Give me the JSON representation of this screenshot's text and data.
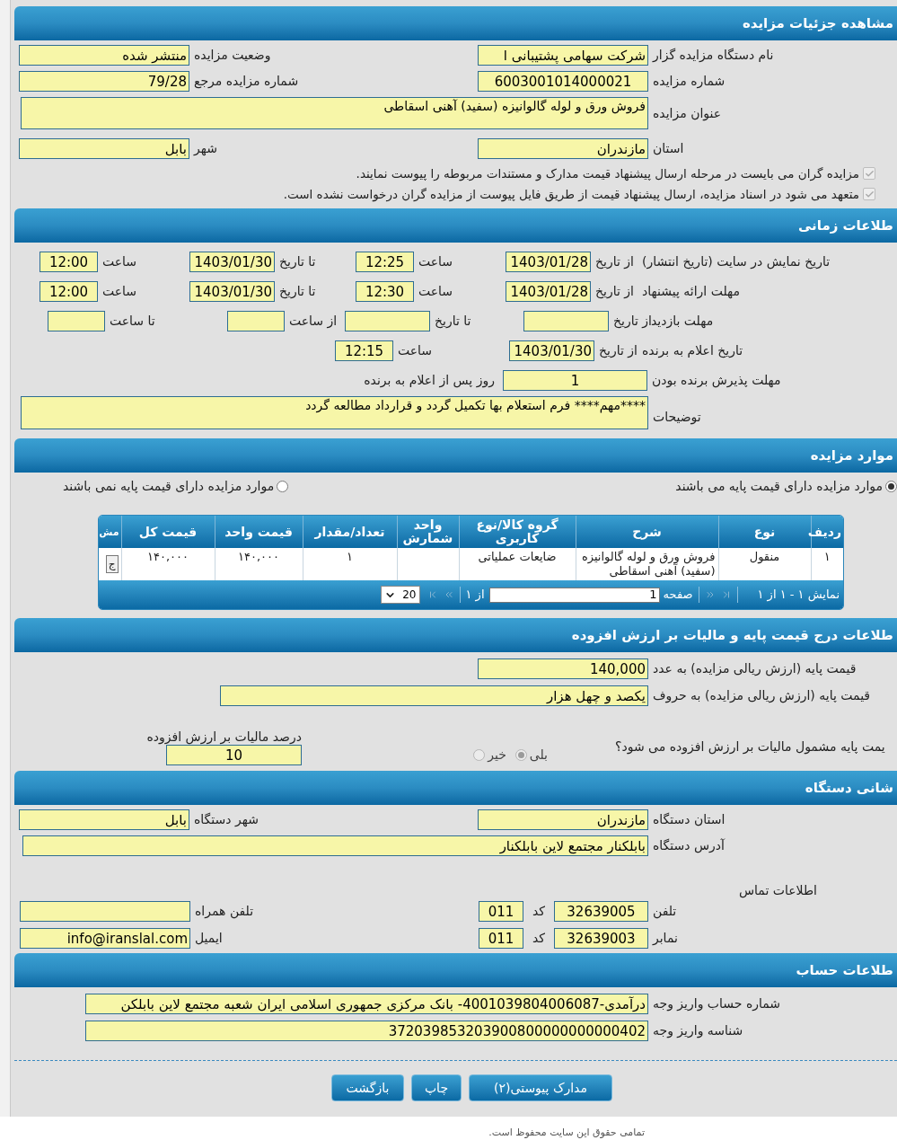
{
  "details": {
    "title": "مشاهده جزئیات مزایده",
    "rows": [
      {
        "kind": "pair",
        "fields": [
          {
            "label": "نام دستگاه مزایده گزار",
            "value": "شرکت سهامی پشتیبانی ا"
          },
          {
            "label": "وضعیت مزایده",
            "value": "منتشر شده"
          }
        ]
      },
      {
        "kind": "pair",
        "fields": [
          {
            "label": "شماره مزایده",
            "value": "6003001014000021"
          },
          {
            "label": "شماره مزایده مرجع",
            "value": "79/28"
          }
        ]
      },
      {
        "kind": "text",
        "fields": [
          {
            "label": "عنوان مزایده",
            "value": "فروش ورق و لوله گالوانیزه (سفید) آهنی اسقاطی"
          }
        ]
      },
      {
        "kind": "pair",
        "fields": [
          {
            "label": "استان",
            "value": "مازندران"
          },
          {
            "label": "شهر",
            "value": "بابل"
          }
        ]
      }
    ],
    "checks": [
      {
        "label": "مزایده گران می بایست در مرحله ارسال پیشنهاد قیمت مدارک و مستندات مربوطه را پیوست نمایند.",
        "checked": true,
        "disabled": true
      },
      {
        "label": "متعهد می شود در اسناد مزایده، ارسال پیشنهاد قیمت از طریق فایل پیوست از مزایده گران درخواست نشده است.",
        "checked": true,
        "disabled": true
      }
    ]
  },
  "time": {
    "title": "طلاعات زمانی",
    "rows": [
      {
        "label": "تاریخ نمایش در سایت (تاریخ انتشار)",
        "parts": [
          {
            "label": "از تاریخ",
            "value": "1403/01/28"
          },
          {
            "label": "ساعت",
            "value": "12:25"
          },
          {
            "label": "تا تاریخ",
            "value": "1403/01/30"
          },
          {
            "label": "ساعت",
            "value": "12:00"
          }
        ]
      },
      {
        "label": "مهلت ارائه پیشنهاد",
        "parts": [
          {
            "label": "از تاریخ",
            "value": "1403/01/28"
          },
          {
            "label": "ساعت",
            "value": "12:30"
          },
          {
            "label": "تا تاریخ",
            "value": "1403/01/30"
          },
          {
            "label": "ساعت",
            "value": "12:00"
          }
        ]
      },
      {
        "label": "مهلت بازدید",
        "parts": [
          {
            "label": "از تاریخ"
          },
          {
            "label": "تا تاریخ"
          },
          {
            "label": "از ساعت"
          },
          {
            "label": "تا ساعت"
          }
        ]
      },
      {
        "label": "تاریخ اعلام به برنده",
        "parts": [
          {
            "label": "از تاریخ",
            "value": "1403/01/30"
          },
          {
            "label": "ساعت",
            "value": "12:15"
          }
        ]
      }
    ],
    "acceptance": {
      "label": "مهلت پذیرش برنده بودن",
      "value": "1",
      "suffix": "روز پس از اعلام به برنده"
    },
    "notes": {
      "label": "توضیحات",
      "value": "****مهم**** فرم استعلام بها تکمیل گردد و قرارداد مطالعه گردد"
    }
  },
  "items": {
    "title": "موارد مزایده",
    "options": [
      {
        "label": "موارد مزایده دارای قیمت پایه می باشند",
        "selected": true
      },
      {
        "label": "موارد مزایده دارای قیمت پایه نمی باشند",
        "selected": false
      }
    ],
    "table": {
      "columns": [
        "ردیف",
        "نوع",
        "شرح",
        "گروه کالا/نوع کاربری",
        "واحد شمارش",
        "تعداد/مقدار",
        "قیمت واحد",
        "قیمت کل",
        "مش"
      ],
      "rows": [
        {
          "cells": [
            "۱",
            "منقول",
            "فروش ورق و لوله گالوانیزه (سفید) آهنی اسقاطی",
            "ضایعات عملیاتی",
            null,
            "۱",
            "۱۴۰,۰۰۰",
            "۱۴۰,۰۰۰"
          ],
          "action": "ج"
        }
      ],
      "pager": {
        "summary": "نمایش ۱ - ۱ از ۱",
        "page_label": "صفحه",
        "page": "1",
        "total": "از ۱",
        "page_size": "20"
      }
    }
  },
  "tax": {
    "title": "طلاعات درج قیمت پایه و مالیات بر ارزش افزوده",
    "rows": [
      {
        "label": "قیمت پایه (ارزش ریالی مزایده) به عدد",
        "value": "140,000"
      },
      {
        "label": "قیمت پایه (ارزش ریالی مزایده) به حروف",
        "value": "یکصد و چهل هزار"
      }
    ],
    "vat": {
      "question": "یمت پایه مشمول مالیات بر ارزش افزوده می شود؟",
      "disabled": true,
      "options": [
        {
          "label": "بلی",
          "selected": true
        },
        {
          "label": "خیر",
          "selected": false
        }
      ],
      "percent_label": "درصد مالیات بر ارزش افزوده",
      "percent": "10"
    }
  },
  "device": {
    "title": "شانی دستگاه",
    "rows": [
      {
        "kind": "pair",
        "fields": [
          {
            "label": "استان دستگاه",
            "value": "مازندران"
          },
          {
            "label": "شهر دستگاه",
            "value": "بابل"
          }
        ]
      },
      {
        "kind": "text",
        "fields": [
          {
            "label": "آدرس دستگاه",
            "value": "بابلکنار مجتمع لاین بابلکنار"
          }
        ]
      }
    ],
    "contact_title": "اطلاعات تماس",
    "contacts": [
      {
        "label": "تلفن",
        "value": "32639005",
        "code_label": "کد",
        "code": "011",
        "other_label": "تلفن همراه"
      },
      {
        "label": "نمابر",
        "value": "32639003",
        "code_label": "کد",
        "code": "011",
        "other_label": "ایمیل",
        "other_value": "info@iranslal.com"
      }
    ]
  },
  "account": {
    "title": "طلاعات حساب",
    "rows": [
      {
        "label": "شماره حساب واریز وجه",
        "value": "درآمدی-4001039804006087- بانک مرکزی جمهوری اسلامی ایران شعبه مجتمع لاین بابلکن"
      },
      {
        "label": "شناسه واریز وجه",
        "value": "372039853203900800000000000402"
      }
    ]
  },
  "buttons": [
    "مدارک پیوستی(۲)",
    "چاپ",
    "بازگشت"
  ],
  "footer": "تمامی حقوق این سایت محفوظ است."
}
